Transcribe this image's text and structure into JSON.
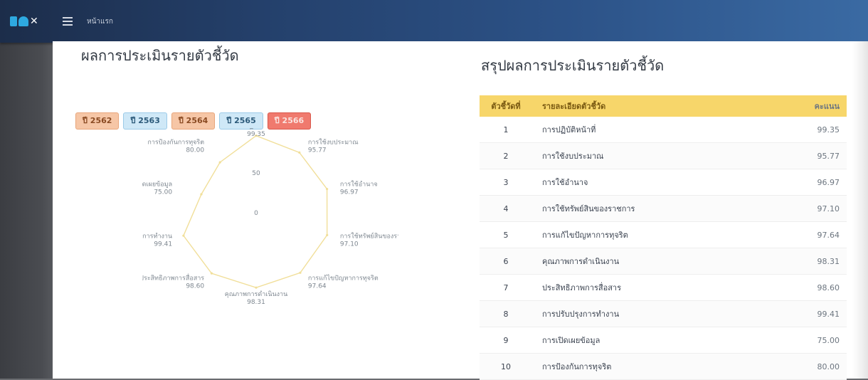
{
  "topbar": {
    "logo_text": "ITA",
    "menu_icon": "hamburger-icon",
    "title": "หน้าแรก"
  },
  "left_section": {
    "title": "ผลการประเมินรายตัวชี้วัด",
    "years": [
      {
        "label": "ปี 2562",
        "color": "#f6c6a6"
      },
      {
        "label": "ปี 2563",
        "color": "#cfe8f7"
      },
      {
        "label": "ปี 2564",
        "color": "#f6c6a6"
      },
      {
        "label": "ปี 2565",
        "color": "#cfe8f7"
      },
      {
        "label": "ปี 2566",
        "color": "#f07a6e"
      }
    ],
    "radar": {
      "scale_labels": [
        "50",
        "0"
      ],
      "axes": [
        {
          "name": "การปฏิบัติหน้าที่",
          "value": "99.35"
        },
        {
          "name": "การใช้งบประมาณ",
          "value": "95.77"
        },
        {
          "name": "การใช้อำนาจ",
          "value": "96.97"
        },
        {
          "name": "การใช้ทรัพย์สินของราชการ",
          "value": "97.10"
        },
        {
          "name": "การแก้ไขปัญหาการทุจริต",
          "value": "97.64"
        },
        {
          "name": "คุณภาพการดำเนินงาน",
          "value": "98.31"
        },
        {
          "name": "ประสิทธิภาพการสื่อสาร",
          "value": "98.60"
        },
        {
          "name": "การปรับปรุงการทำงาน",
          "value": "99.41"
        },
        {
          "name": "การเปิดเผยข้อมูล",
          "value": "75.00"
        },
        {
          "name": "การป้องกันการทุจริต",
          "value": "80.00"
        }
      ]
    }
  },
  "right_section": {
    "title": "สรุปผลการประเมินรายตัวชี้วัด",
    "columns": [
      "ตัวชี้วัดที่",
      "รายละเอียดตัวชี้วัด",
      "คะแนน"
    ],
    "rows": [
      {
        "no": "1",
        "name": "การปฏิบัติหน้าที่",
        "score": "99.35"
      },
      {
        "no": "2",
        "name": "การใช้งบประมาณ",
        "score": "95.77"
      },
      {
        "no": "3",
        "name": "การใช้อำนาจ",
        "score": "96.97"
      },
      {
        "no": "4",
        "name": "การใช้ทรัพย์สินของราชการ",
        "score": "97.10"
      },
      {
        "no": "5",
        "name": "การแก้ไขปัญหาการทุจริต",
        "score": "97.64"
      },
      {
        "no": "6",
        "name": "คุณภาพการดำเนินงาน",
        "score": "98.31"
      },
      {
        "no": "7",
        "name": "ประสิทธิภาพการสื่อสาร",
        "score": "98.60"
      },
      {
        "no": "8",
        "name": "การปรับปรุงการทำงาน",
        "score": "99.41"
      },
      {
        "no": "9",
        "name": "การเปิดเผยข้อมูล",
        "score": "75.00"
      },
      {
        "no": "10",
        "name": "การป้องกันการทุจริต",
        "score": "80.00"
      }
    ]
  },
  "chart_data": {
    "type": "radar",
    "categories": [
      "การปฏิบัติหน้าที่",
      "การใช้งบประมาณ",
      "การใช้อำนาจ",
      "การใช้ทรัพย์สินของราชการ",
      "การแก้ไขปัญหาการทุจริต",
      "คุณภาพการดำเนินงาน",
      "ประสิทธิภาพการสื่อสาร",
      "การปรับปรุงการทำงาน",
      "การเปิดเผยข้อมูล",
      "การป้องกันการทุจริต"
    ],
    "values": [
      99.35,
      95.77,
      96.97,
      97.1,
      97.64,
      98.31,
      98.6,
      99.41,
      75.0,
      80.0
    ],
    "range": [
      0,
      100
    ],
    "line_color": "#f1df9a"
  }
}
